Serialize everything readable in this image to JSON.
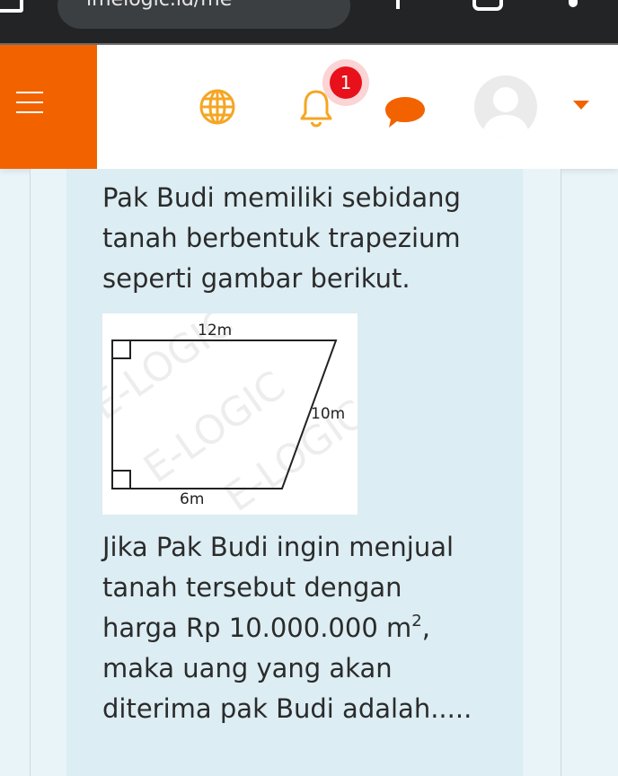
{
  "status_bar": {
    "url_text": "imelogic.id/me"
  },
  "nav": {
    "notification_count": "1"
  },
  "question": {
    "intro": "Pak Budi memiliki sebidang tanah berbentuk trapezium seperti gambar berikut.",
    "ask_line1": "Jika Pak Budi ingin menjual",
    "ask_line2": "tanah tersebut dengan",
    "ask_price": "harga Rp 10.000.000 m",
    "ask_price_sup": "2",
    "ask_price_tail": ",",
    "ask_line4": "maka uang yang akan",
    "ask_line5": "diterima pak Budi adalah....."
  },
  "figure": {
    "top_label": "12m",
    "slant_label": "10m",
    "bottom_label": "6m",
    "watermark": "E-LOGIC"
  },
  "colors": {
    "accent": "#f26300",
    "badge": "#e8101a",
    "nav_icon": "#f5a623",
    "chat_icon": "#f26300",
    "card": "#dcedf3"
  }
}
